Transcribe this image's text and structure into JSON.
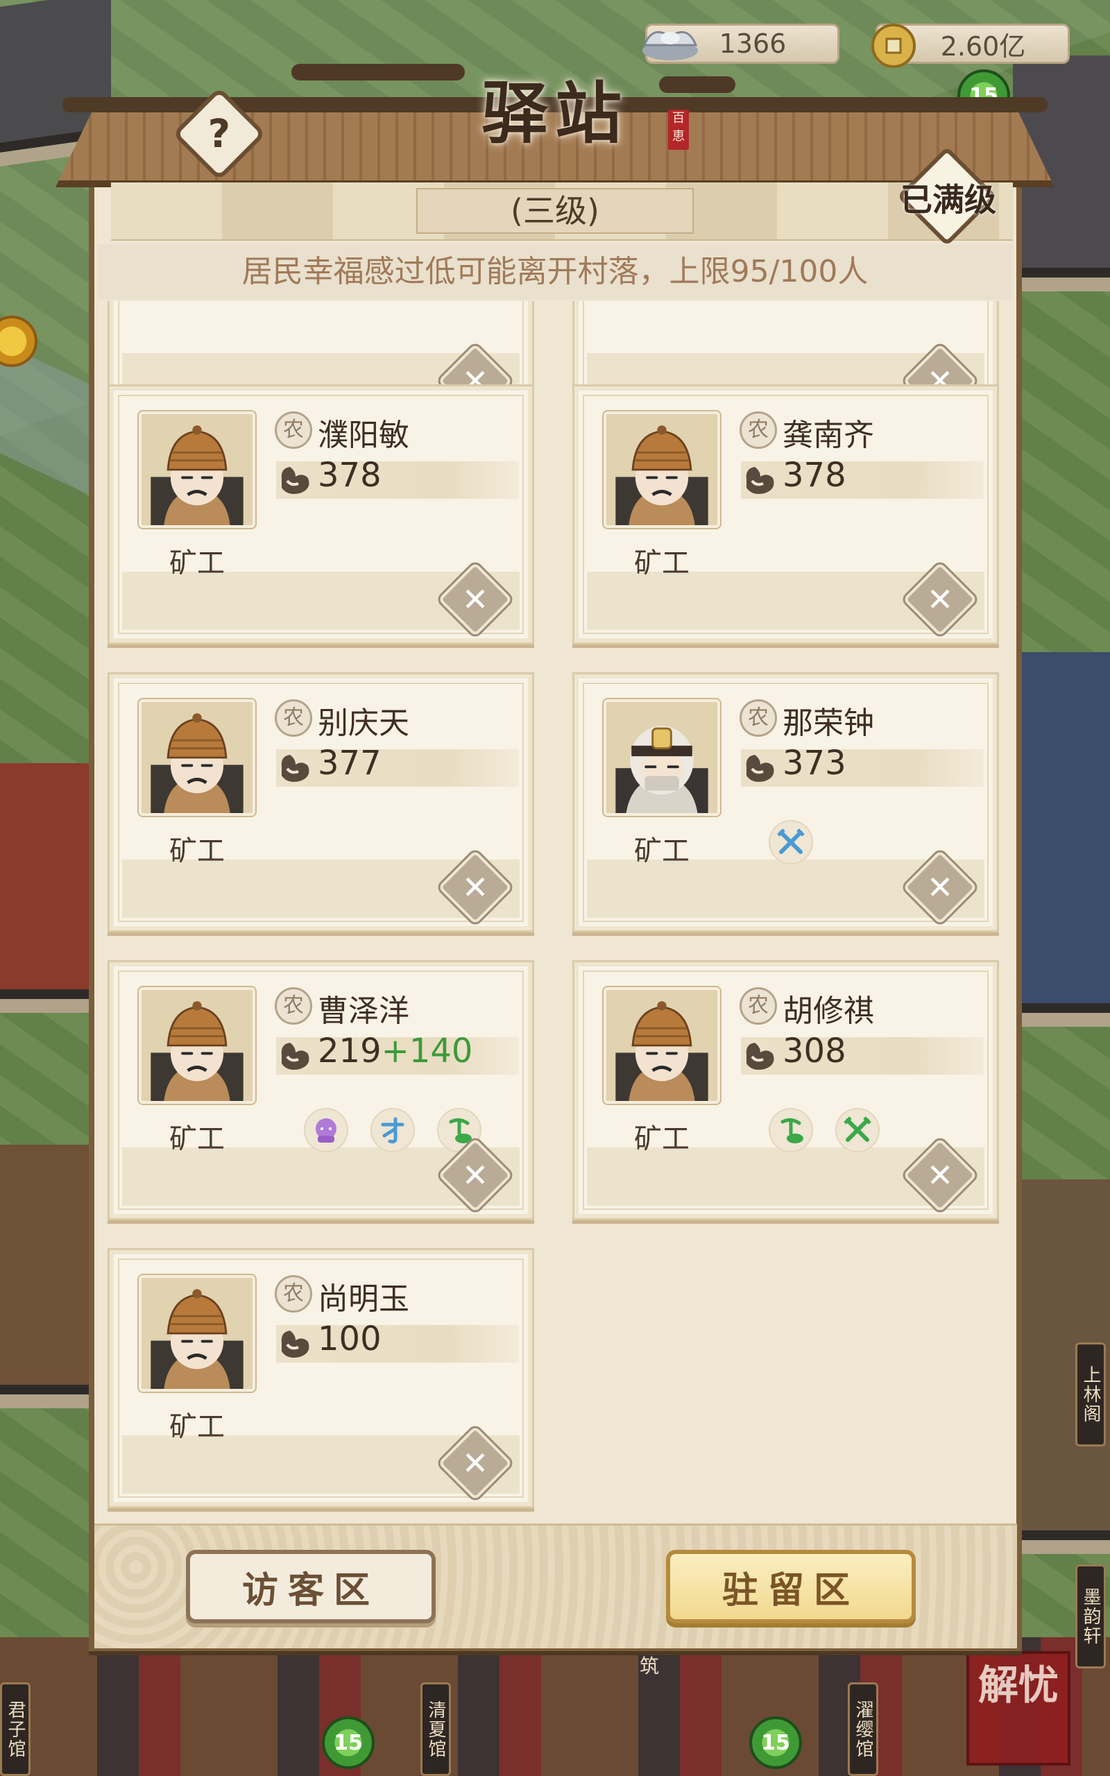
{
  "currency": {
    "silver": {
      "icon": "silver-ingot-icon",
      "amount": "1366"
    },
    "coins": {
      "icon": "copper-coin-icon",
      "amount": "2.60亿"
    }
  },
  "panel": {
    "title": "驿站",
    "seal_text": "百恵",
    "help_label": "?",
    "level_text": "(三级)",
    "max_level_badge": "已满级",
    "notice": "居民幸福感过低可能离开村落，上限95/100人"
  },
  "residents": [
    {
      "name": "",
      "job": "",
      "power": "",
      "portrait": "miner-hat",
      "traits": [],
      "partial": true
    },
    {
      "name": "",
      "job": "",
      "power": "",
      "portrait": "miner-hat",
      "traits": [],
      "partial": true
    },
    {
      "name": "濮阳敏",
      "job": "矿工",
      "badge": "农",
      "power": "378",
      "portrait": "miner-hat",
      "traits": []
    },
    {
      "name": "龚南齐",
      "job": "矿工",
      "badge": "农",
      "power": "378",
      "portrait": "miner-hat",
      "traits": []
    },
    {
      "name": "别庆天",
      "job": "矿工",
      "badge": "农",
      "power": "377",
      "portrait": "miner-hat",
      "traits": []
    },
    {
      "name": "那荣钟",
      "job": "矿工",
      "badge": "农",
      "power": "373",
      "portrait": "miner-headlamp",
      "traits": [
        "crossed-picks-blue-icon"
      ]
    },
    {
      "name": "曹泽洋",
      "job": "矿工",
      "badge": "农",
      "power": "219",
      "power_bonus": "+140",
      "portrait": "miner-hat",
      "traits": [
        "purple-head-icon",
        "blue-talent-icon",
        "green-pick-icon"
      ]
    },
    {
      "name": "胡修祺",
      "job": "矿工",
      "badge": "农",
      "power": "308",
      "portrait": "miner-hat",
      "traits": [
        "green-pick-icon",
        "crossed-picks-green-icon"
      ]
    },
    {
      "name": "尚明玉",
      "job": "矿工",
      "badge": "农",
      "power": "100",
      "portrait": "miner-hat",
      "traits": []
    }
  ],
  "tabs": {
    "visitor": "访客区",
    "stay": "驻留区",
    "active": "stay"
  },
  "map_labels": {
    "shanglin": "上林阁",
    "moyun": "墨韵轩",
    "junzi": "君子馆",
    "qingxia": "清夏馆",
    "zhuoying": "濯缨馆",
    "zhu": "筑",
    "level_up_badge": "15",
    "stamp": "解忧"
  },
  "colors": {
    "panel_bg": "#efe6d3",
    "bonus_green": "#3c9a37",
    "frame_brown": "#7a5d3a",
    "active_tab_gold": "#f1d98f"
  }
}
